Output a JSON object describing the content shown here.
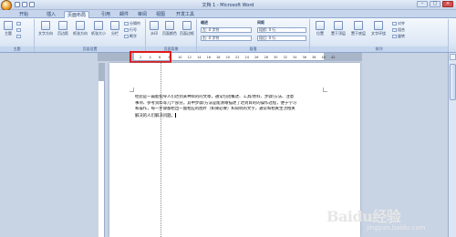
{
  "window": {
    "title": "文档 1 - Microsoft Word",
    "controls": [
      "–",
      "□",
      "×"
    ]
  },
  "tabs": [
    "开始",
    "插入",
    "页面布局",
    "引用",
    "邮件",
    "审阅",
    "视图",
    "开发工具"
  ],
  "active_tab": "页面布局",
  "ribbon": {
    "groups": [
      {
        "label": "主题",
        "buttons": [
          "主题"
        ]
      },
      {
        "label": "页面设置",
        "buttons": [
          "文字方向",
          "页边距",
          "纸张方向",
          "纸张大小",
          "分栏"
        ],
        "small": [
          "分隔符",
          "行号",
          "断字"
        ]
      },
      {
        "label": "页面背景",
        "buttons": [
          "水印",
          "页面颜色",
          "页面边框"
        ]
      },
      {
        "label": "段落",
        "indent_header": "缩进",
        "spacing_header": "间距",
        "left": "左: 0 字符",
        "right": "右: 0 字符",
        "before": "段前: 0 行",
        "after": "段后: 0 行"
      },
      {
        "label": "排列",
        "buttons": [
          "位置",
          "置于顶层",
          "置于底层",
          "文字环绕",
          "对齐",
          "组合",
          "旋转"
        ]
      }
    ]
  },
  "ruler": {
    "ticks": [
      "2",
      "4",
      "6",
      "8",
      "10",
      "12",
      "14",
      "16",
      "18",
      "20",
      "22",
      "24",
      "26",
      "28",
      "30",
      "32",
      "34",
      "36",
      "38",
      "40",
      "42"
    ]
  },
  "document": {
    "lines": [
      "经验是一篇能指导人们达到某种目的的文章，通常包括概述、工具/原料、步骤/方法、注意",
      "事项、参考资料等几个部分。其中步骤/方法是能清晰描述了达到目的的操作过程，便于学习",
      "和操作，每一步骤都给出一副相应的图片（如果必要）和简明的文字，通常和相关生活相关",
      "解决的人们解决问题。"
    ]
  },
  "watermark": {
    "logo": "Baidu经验",
    "url": "jingyan.baidu.com"
  }
}
